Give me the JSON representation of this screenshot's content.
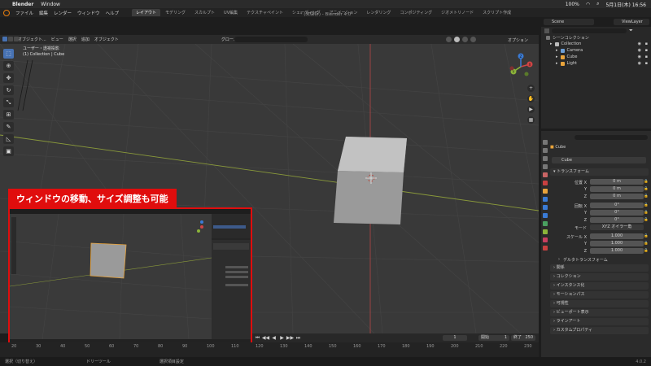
{
  "macos": {
    "apple": "",
    "app": "Blender",
    "menu": [
      "Window"
    ],
    "battery": "100%",
    "datetime": "5月1日(木) 16:56"
  },
  "blender": {
    "title": "* (未保存) - Blender 4.0",
    "menus": [
      "ファイル",
      "編集",
      "レンダー",
      "ウィンドウ",
      "ヘルプ"
    ],
    "tabs": [
      {
        "label": "レイアウト",
        "active": true
      },
      {
        "label": "モデリング",
        "active": false
      },
      {
        "label": "スカルプト",
        "active": false
      },
      {
        "label": "UV編集",
        "active": false
      },
      {
        "label": "テクスチャペイント",
        "active": false
      },
      {
        "label": "シェーディング",
        "active": false
      },
      {
        "label": "アニメーション",
        "active": false
      },
      {
        "label": "レンダリング",
        "active": false
      },
      {
        "label": "コンポジティング",
        "active": false
      },
      {
        "label": "ジオメトリノード",
        "active": false
      },
      {
        "label": "スクリプト作成",
        "active": false
      }
    ],
    "scene": "Scene",
    "view_layer": "ViewLayer"
  },
  "viewport": {
    "header_items": [
      "オブジェクト...",
      "ビュー",
      "選択",
      "追加",
      "オブジェクト"
    ],
    "transform_orient": "グロー...",
    "options_label": "オプション",
    "info_line1": "ユーザー・透視投影",
    "info_line2": "(1) Collection | Cube",
    "tools": [
      {
        "icon": "select-box-icon",
        "glyph": "⬚",
        "active": true
      },
      {
        "icon": "cursor-icon",
        "glyph": "⊕",
        "active": false
      },
      {
        "icon": "move-icon",
        "glyph": "✥",
        "active": false
      },
      {
        "icon": "rotate-icon",
        "glyph": "↻",
        "active": false
      },
      {
        "icon": "scale-icon",
        "glyph": "⤡",
        "active": false
      },
      {
        "icon": "transform-icon",
        "glyph": "⊞",
        "active": false
      },
      {
        "icon": "annotate-icon",
        "glyph": "✎",
        "active": false
      },
      {
        "icon": "measure-icon",
        "glyph": "◺",
        "active": false
      },
      {
        "icon": "add-cube-icon",
        "glyph": "▣",
        "active": false
      }
    ],
    "nav_buttons": [
      {
        "icon": "zoom-icon",
        "glyph": "+"
      },
      {
        "icon": "hand-icon",
        "glyph": "✋"
      },
      {
        "icon": "camera-view-icon",
        "glyph": "▶"
      },
      {
        "icon": "grid-view-icon",
        "glyph": "▦"
      }
    ],
    "gizmo": {
      "x_label": "X",
      "y_label": "Y",
      "z_label": "Z"
    }
  },
  "annotation": {
    "label": "ウィンドウの移動、サイズ調整も可能",
    "color": "#e00d0d"
  },
  "timeline": {
    "current_frame": "1",
    "start_label": "開始",
    "start_value": "1",
    "end_label": "終了",
    "end_value": "250",
    "ruler": [
      "20",
      "30",
      "40",
      "50",
      "60",
      "70",
      "80",
      "90",
      "100",
      "110",
      "120",
      "130",
      "140",
      "150",
      "160",
      "170",
      "180",
      "190",
      "200",
      "210",
      "220",
      "230"
    ]
  },
  "statusbar": {
    "items": [
      "選択（切り替え）",
      "ドリーツール",
      "選択項目設定"
    ],
    "version": "4.0.2"
  },
  "outliner": {
    "root": "シーンコレクション",
    "items": [
      {
        "name": "Collection",
        "color": "#bbbbbb",
        "indent": 1
      },
      {
        "name": "Camera",
        "color": "#6c9ed6",
        "indent": 2
      },
      {
        "name": "Cube",
        "color": "#e8a33b",
        "indent": 2
      },
      {
        "name": "Light",
        "color": "#e8a33b",
        "indent": 2
      }
    ]
  },
  "properties": {
    "object": "Cube",
    "name_field": "Cube",
    "transform_header": "トランスフォーム",
    "location": {
      "label": "位置 X",
      "x": "0 m",
      "y": "0 m",
      "z": "0 m"
    },
    "rotation": {
      "label": "回転 X",
      "x": "0°",
      "y": "0°",
      "z": "0°"
    },
    "mode": {
      "label": "モード",
      "value": "XYZ オイラー角"
    },
    "scale": {
      "label": "スケール X",
      "x": "1.000",
      "y": "1.000",
      "z": "1.000"
    },
    "axis_y": "Y",
    "axis_z": "Z",
    "delta_transform": "デルタトランスフォーム",
    "sections": [
      "関係",
      "コレクション",
      "インスタンス化",
      "モーションパス",
      "可視性",
      "ビューポート表示",
      "ラインアート",
      "カスタムプロパティ"
    ]
  }
}
